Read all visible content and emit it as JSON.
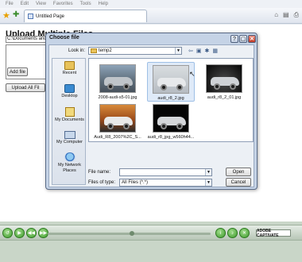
{
  "browser": {
    "menu": [
      "File",
      "Edit",
      "View",
      "Favorites",
      "Tools",
      "Help"
    ],
    "tab_title": "Untitled Page",
    "right_icons": [
      "home-icon",
      "feeds-icon",
      "print-icon"
    ]
  },
  "page": {
    "title": "Upload Multiple Files",
    "path_value": "C:\\Documents and",
    "add_file_label": "Add file",
    "upload_all_label": "Upload All Fil"
  },
  "dialog": {
    "title": "Choose file",
    "look_in_label": "Look in:",
    "look_in_value": "temp2",
    "places": [
      "Recent",
      "Desktop",
      "My Documents",
      "My Computer",
      "My Network Places"
    ],
    "files": [
      {
        "name": "2008-audi-s5-01.jpg",
        "selected": false
      },
      {
        "name": "audi_r8_2.jpg",
        "selected": true
      },
      {
        "name": "audi_r8_2_01.jpg",
        "selected": false
      },
      {
        "name": "Audi_R8_2007%2C_S...",
        "selected": false
      },
      {
        "name": "audi_r8_jpg_w560h44...",
        "selected": false
      }
    ],
    "file_name_label": "File name:",
    "file_name_value": "",
    "files_of_type_label": "Files of type:",
    "files_of_type_value": "All Files (*.*)",
    "open_label": "Open",
    "cancel_label": "Cancel"
  },
  "player": {
    "branding": "ADOBE CAPTIVATE"
  }
}
